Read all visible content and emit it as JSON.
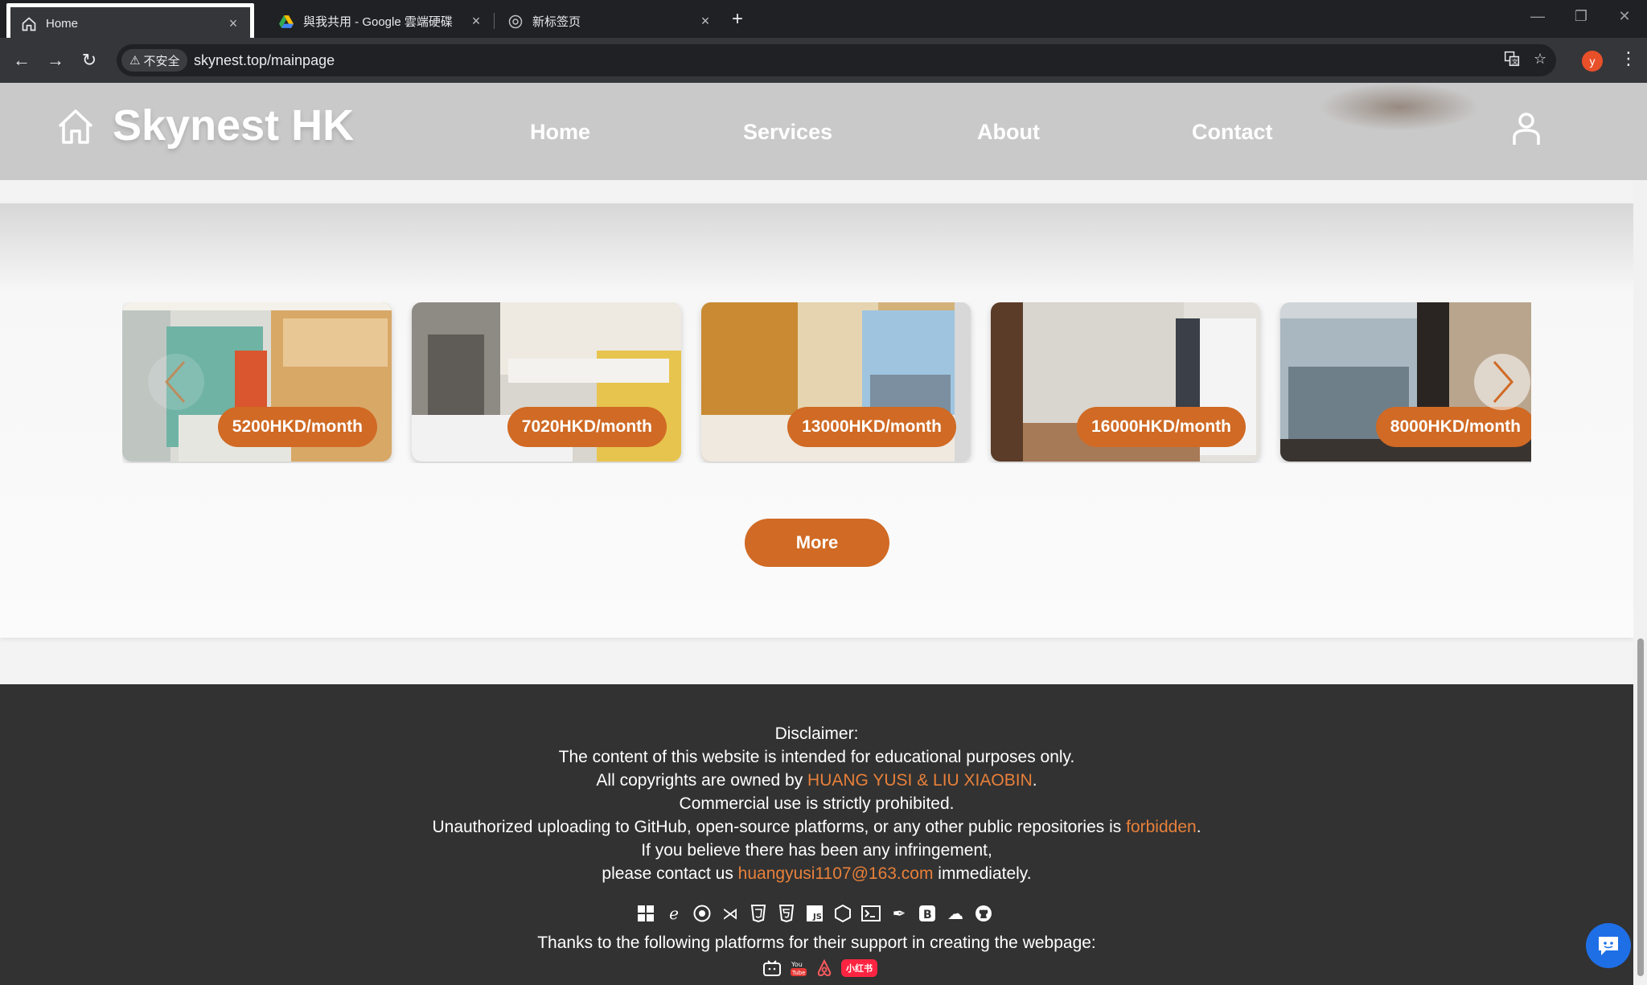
{
  "browser": {
    "tabs": [
      {
        "title": "Home",
        "icon": "home-icon",
        "active": true
      },
      {
        "title": "與我共用 - Google 雲端硬碟",
        "icon": "google-drive-icon",
        "active": false
      },
      {
        "title": "新标签页",
        "icon": "chrome-icon",
        "active": false
      }
    ],
    "security_label": "不安全",
    "url": "skynest.top/mainpage",
    "profile_initial": "y"
  },
  "site": {
    "brand": "Skynest HK",
    "nav": [
      "Home",
      "Services",
      "About",
      "Contact"
    ]
  },
  "listings": [
    {
      "price": "5200HKD/month"
    },
    {
      "price": "7020HKD/month"
    },
    {
      "price": "13000HKD/month"
    },
    {
      "price": "16000HKD/month"
    },
    {
      "price": "8000HKD/month"
    }
  ],
  "more_label": "More",
  "footer": {
    "disclaimer_title": "Disclaimer:",
    "line1": "The content of this website is intended for educational purposes only.",
    "line2_pre": "All copyrights are owned by ",
    "line2_link": "HUANG YUSI & LIU XIAOBIN",
    "line2_post": ".",
    "line3": "Commercial use is strictly prohibited.",
    "line4_pre": "Unauthorized uploading to GitHub, open-source platforms, or any other public repositories is ",
    "line4_link": "forbidden",
    "line4_post": ".",
    "line5": "If you believe there has been any infringement,",
    "line6_pre": "please contact us ",
    "line6_link": "huangyusi1107@163.com",
    "line6_post": " immediately.",
    "thanks": "Thanks to the following platforms for their support in creating the webpage:",
    "tech_icons": [
      "windows-icon",
      "edge-icon",
      "chrome-icon",
      "vscode-icon",
      "css3-icon",
      "html5-icon",
      "javascript-icon",
      "nodejs-icon",
      "terminal-icon",
      "feather-icon",
      "bootstrap-icon",
      "cloud-icon",
      "github-icon"
    ],
    "platform_icons": [
      "bilibili-icon",
      "youtube-icon",
      "airbnb-icon",
      "xiaohongshu-icon"
    ],
    "xiaohongshu_label": "小红书"
  },
  "colors": {
    "accent": "#d06a24",
    "footer_bg": "#323232",
    "header_bg": "#c9c9c9",
    "link": "#e8803a"
  }
}
